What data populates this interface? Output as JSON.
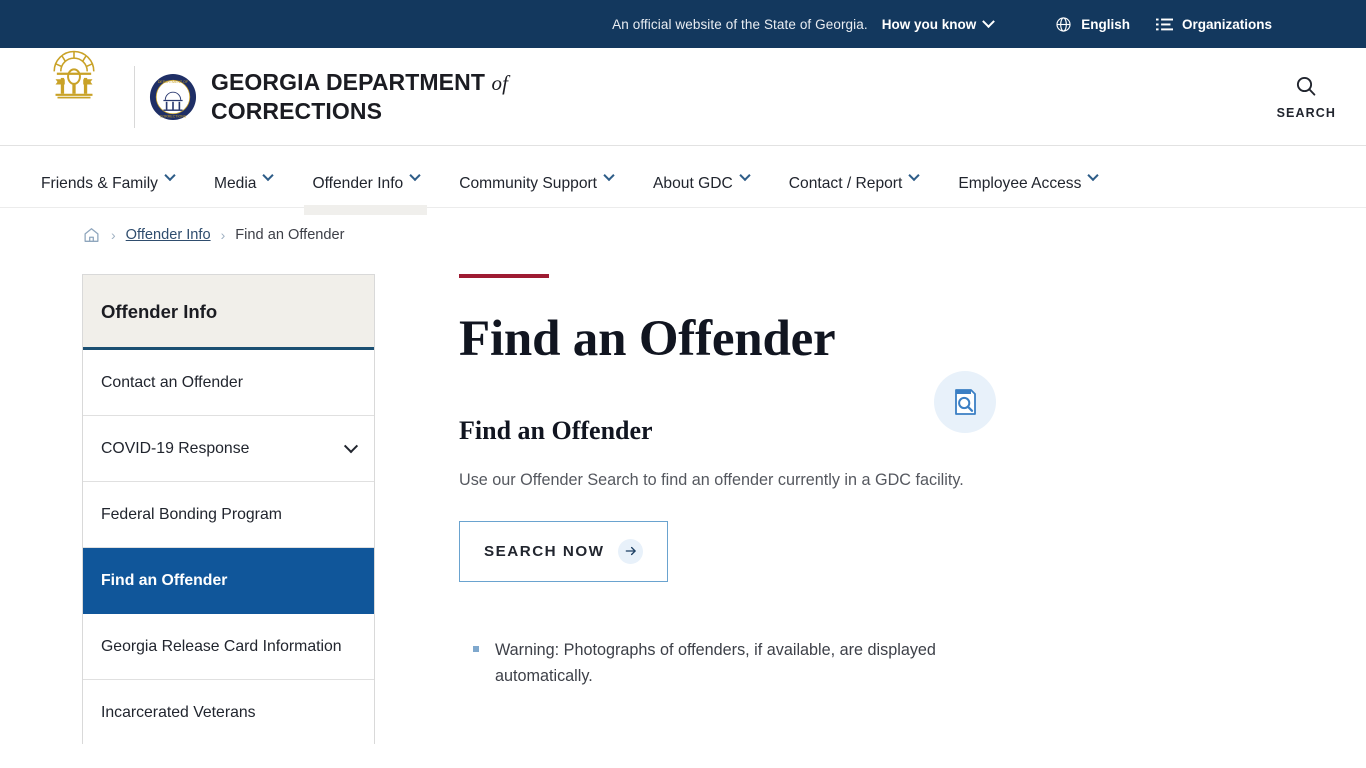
{
  "gov_bar": {
    "official_text": "An official website of the State of Georgia.",
    "how_you_know": "How you know",
    "language": "English",
    "organizations": "Organizations",
    "globe_icon": "globe-icon",
    "list_icon": "list-icon",
    "chevron_icon": "chevron-down-icon",
    "background": "#13385e"
  },
  "masthead": {
    "arch_logo": "georgia-arch-logo",
    "seal_logo": "gdc-seal-logo",
    "brand_line1_a": "GEORGIA DEPARTMENT",
    "brand_line1_b": "of",
    "brand_line2": "CORRECTIONS",
    "search_label": "SEARCH",
    "search_icon": "search-icon"
  },
  "primary_nav": {
    "items": [
      {
        "label": "Friends & Family",
        "has_caret": true,
        "active": false
      },
      {
        "label": "Media",
        "has_caret": true,
        "active": false
      },
      {
        "label": "Offender Info",
        "has_caret": true,
        "active": true
      },
      {
        "label": "Community Support",
        "has_caret": true,
        "active": false
      },
      {
        "label": "About GDC",
        "has_caret": true,
        "active": false
      },
      {
        "label": "Contact / Report",
        "has_caret": true,
        "active": false
      },
      {
        "label": "Employee Access",
        "has_caret": true,
        "active": false
      }
    ]
  },
  "breadcrumb": {
    "home_icon": "home-icon",
    "separator": "›",
    "parent": "Offender Info",
    "current": "Find an Offender"
  },
  "sidebar": {
    "header": "Offender Info",
    "items": [
      {
        "label": "Contact an Offender",
        "expandable": false,
        "active": false
      },
      {
        "label": "COVID-19 Response",
        "expandable": true,
        "active": false
      },
      {
        "label": "Federal Bonding Program",
        "expandable": false,
        "active": false
      },
      {
        "label": "Find an Offender",
        "expandable": false,
        "active": true
      },
      {
        "label": "Georgia Release Card Information",
        "expandable": false,
        "active": false
      },
      {
        "label": "Incarcerated Veterans",
        "expandable": false,
        "active": false
      }
    ],
    "active_color": "#10569a",
    "header_bg": "#f1efea",
    "header_rule": "#1b4f72"
  },
  "main": {
    "accent_color": "#9e1b32",
    "page_title": "Find an Offender",
    "section_title": "Find an Offender",
    "section_icon": "document-search-icon",
    "lede": "Use our Offender Search to find an offender currently in a GDC facility.",
    "cta_label": "SEARCH NOW",
    "cta_arrow_icon": "arrow-right-icon",
    "notes": [
      "Warning: Photographs of offenders, if available, are displayed automatically."
    ]
  }
}
